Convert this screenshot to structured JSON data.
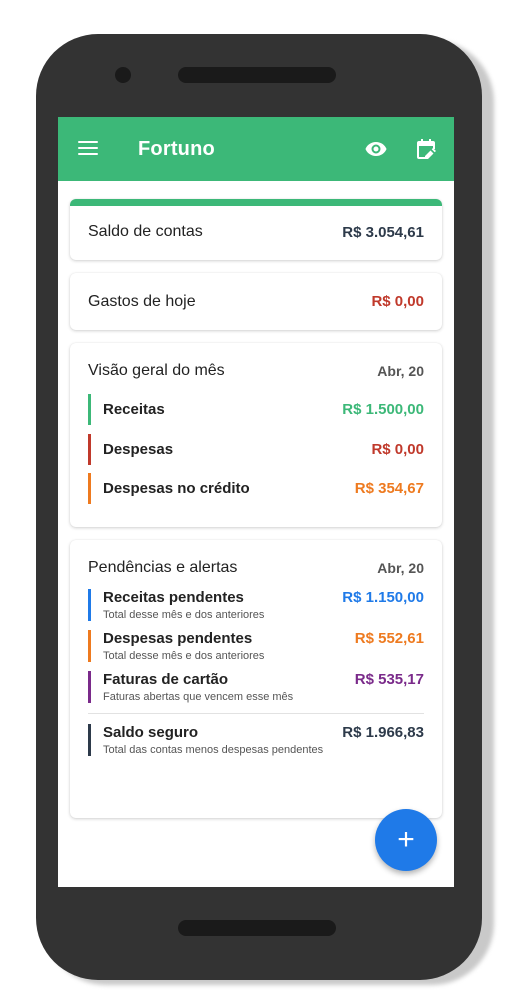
{
  "appbar": {
    "title": "Fortuno",
    "icons": [
      "menu-icon",
      "eye-icon",
      "calendar-edit-icon"
    ]
  },
  "saldo": {
    "label": "Saldo de contas",
    "amount": "R$ 3.054,61",
    "color": "#2d3a4a"
  },
  "gastos": {
    "label": "Gastos de hoje",
    "amount": "R$ 0,00",
    "color": "#c0392b"
  },
  "visao": {
    "title": "Visão geral do mês",
    "date": "Abr, 20",
    "items": [
      {
        "label": "Receitas",
        "amount": "R$ 1.500,00",
        "color": "#3cb878"
      },
      {
        "label": "Despesas",
        "amount": "R$ 0,00",
        "color": "#c0392b"
      },
      {
        "label": "Despesas no crédito",
        "amount": "R$ 354,67",
        "color": "#ee7a1f"
      }
    ]
  },
  "pendencias": {
    "title": "Pendências e alertas",
    "date": "Abr, 20",
    "items": [
      {
        "label": "Receitas pendentes",
        "sub": "Total desse mês e dos anteriores",
        "amount": "R$ 1.150,00",
        "color": "#1f7ae8"
      },
      {
        "label": "Despesas pendentes",
        "sub": "Total desse mês e dos anteriores",
        "amount": "R$ 552,61",
        "color": "#ee7a1f"
      },
      {
        "label": "Faturas de cartão",
        "sub": "Faturas abertas que vencem esse mês",
        "amount": "R$ 535,17",
        "color": "#7a2a8a"
      }
    ],
    "seguro": {
      "label": "Saldo seguro",
      "sub": "Total das contas menos despesas pendentes",
      "amount": "R$ 1.966,83",
      "color": "#2d3a4a"
    }
  },
  "fab": {
    "label": "+",
    "icon": "plus-icon",
    "color": "#1f7ae8"
  }
}
